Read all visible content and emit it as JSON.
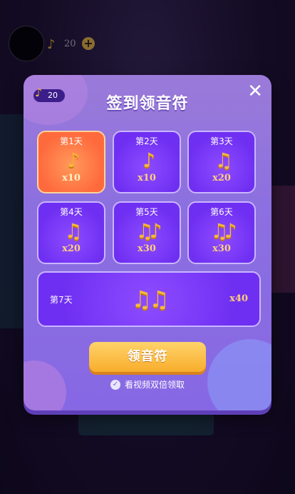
{
  "topbar": {
    "coin_icon": "music-note-icon",
    "coin_count": "20",
    "add_icon": "plus-icon"
  },
  "dialog": {
    "title": "签到领音符",
    "balance": "20",
    "close_label": "✕",
    "days": [
      {
        "label": "第1天",
        "notes": "♪",
        "amount": "x10",
        "active": true
      },
      {
        "label": "第2天",
        "notes": "♪",
        "amount": "x10",
        "active": false
      },
      {
        "label": "第3天",
        "notes": "♫",
        "amount": "x20",
        "active": false
      },
      {
        "label": "第4天",
        "notes": "♫",
        "amount": "x20",
        "active": false
      },
      {
        "label": "第5天",
        "notes": "♫♪",
        "amount": "x30",
        "active": false
      },
      {
        "label": "第6天",
        "notes": "♫♪",
        "amount": "x30",
        "active": false
      }
    ],
    "day7": {
      "label": "第7天",
      "notes": "♫♫",
      "amount": "x40"
    },
    "claim_button": "领音符",
    "double_option": "看视频双倍领取"
  },
  "colors": {
    "accent": "#8768e4",
    "claim": "#f8ad2c",
    "active_day": "#ff6a3d",
    "note": "#f6b93b"
  }
}
